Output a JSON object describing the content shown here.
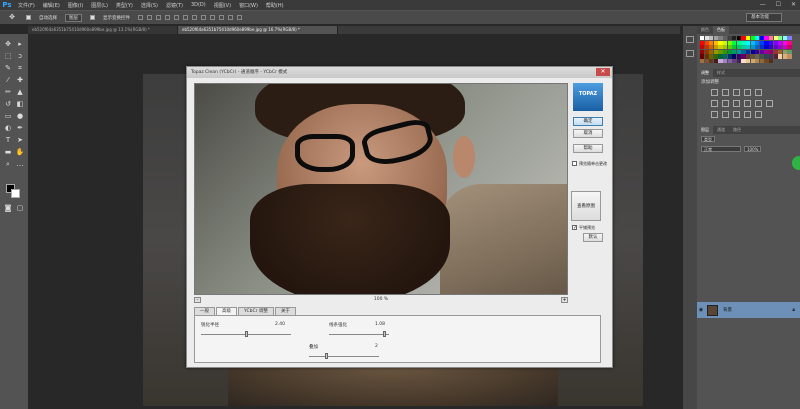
{
  "app": {
    "logo": "Ps"
  },
  "menu": [
    "文件(F)",
    "编辑(E)",
    "图像(I)",
    "图层(L)",
    "类型(Y)",
    "选择(S)",
    "滤镜(T)",
    "3D(D)",
    "视图(V)",
    "窗口(W)",
    "帮助(H)"
  ],
  "window_controls": [
    "—",
    "☐",
    "✕"
  ],
  "options_bar": {
    "auto_select_label": "自动选择",
    "auto_select_value": "图层",
    "show_transform_label": "显示变换控件",
    "workspace": "基本功能"
  },
  "doc_tabs": [
    {
      "title": "eb520f64a6351b75410d960e899be.jpg @ 13.1%(RGB/8) *"
    },
    {
      "title": "eb520f64a6351b75410d960e899be.jpg @ 16.7%(RGB/8) *"
    }
  ],
  "panels": {
    "swatch_tabs": [
      "颜色",
      "色板"
    ],
    "adjust_tabs": [
      "调整",
      "样式"
    ],
    "adjust_title": "添加调整",
    "layer_tabs": [
      "图层",
      "通道",
      "路径"
    ],
    "layer_kind": "类型",
    "blend_mode": "正常",
    "opacity": "100%",
    "layer_name": "背景"
  },
  "swatch_colors": [
    "#ffffff",
    "#e0e0e0",
    "#c0c0c0",
    "#a0a0a0",
    "#808080",
    "#606060",
    "#404040",
    "#202020",
    "#000000",
    "#ff0000",
    "#ffff00",
    "#00ff00",
    "#00ffff",
    "#0000ff",
    "#ff00ff",
    "#ff8080",
    "#ffff80",
    "#80ff80",
    "#80ffff",
    "#8080ff",
    "#ff0000",
    "#ff4000",
    "#ff8000",
    "#ffbf00",
    "#ffff00",
    "#bfff00",
    "#80ff00",
    "#00ff40",
    "#00ff80",
    "#00ffbf",
    "#00ffff",
    "#00bfff",
    "#0080ff",
    "#0040ff",
    "#0000ff",
    "#4000ff",
    "#8000ff",
    "#bf00ff",
    "#ff00ff",
    "#ff0080",
    "#cc0000",
    "#cc3300",
    "#cc6600",
    "#cc9900",
    "#cccc00",
    "#99cc00",
    "#66cc00",
    "#00cc33",
    "#00cc66",
    "#00cc99",
    "#00cccc",
    "#0099cc",
    "#0066cc",
    "#0033cc",
    "#0000cc",
    "#3300cc",
    "#6600cc",
    "#9900cc",
    "#cc00cc",
    "#cc0066",
    "#990000",
    "#993300",
    "#996600",
    "#999900",
    "#669900",
    "#339900",
    "#009933",
    "#009966",
    "#009999",
    "#006699",
    "#003399",
    "#000099",
    "#330099",
    "#660099",
    "#990099",
    "#990066",
    "#993333",
    "#996633",
    "#999966",
    "#669966",
    "#660000",
    "#663300",
    "#666600",
    "#336600",
    "#006633",
    "#006666",
    "#003366",
    "#000066",
    "#330066",
    "#660066",
    "#663333",
    "#665533",
    "#666655",
    "#445544",
    "#334455",
    "#443355",
    "#552233",
    "#f0d0a0",
    "#d8b080",
    "#c09060",
    "#a07040",
    "#805030",
    "#603820",
    "#402010",
    "#c8a8d8",
    "#a080c0",
    "#8060a0",
    "#604080",
    "#402060",
    "#f8e0c0",
    "#e8c898",
    "#d0a870",
    "#b08850",
    "#906838",
    "#704828",
    "#503018"
  ],
  "dialog": {
    "title": "Topaz Clean (YCbCr) - 通道顺序 - YCbCr 模式",
    "close": "✕",
    "logo": "TOPAZ",
    "ok": "确定",
    "cancel": "取消",
    "help": "帮助",
    "preview_changes": "预览随单击更改",
    "original": "查看原图",
    "split_label": "平铺预览",
    "reset": "默认",
    "zoom": "100 %",
    "zoom_minus": "-",
    "zoom_plus": "+",
    "tabs": [
      "一般",
      "高级",
      "YCbCr 调整",
      "关于"
    ],
    "params": {
      "sharpen_label": "锐化半径",
      "sharpen_value": "2.40",
      "edge_label": "线条强化",
      "edge_value": "1.08",
      "blend_label": "叠加",
      "blend_value": "2"
    }
  }
}
